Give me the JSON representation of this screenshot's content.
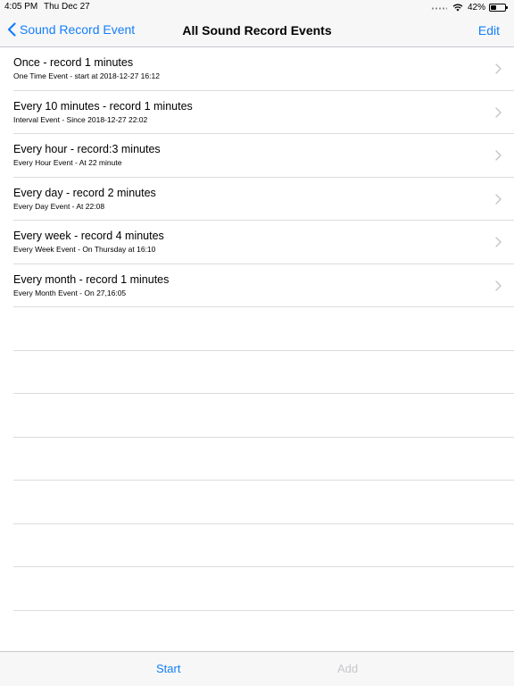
{
  "status_bar": {
    "time": "4:05 PM",
    "date": "Thu Dec 27",
    "battery_percent": "42%",
    "battery_level": 0.42
  },
  "nav": {
    "back_label": "Sound Record Event",
    "title": "All Sound Record Events",
    "edit_label": "Edit"
  },
  "events": [
    {
      "title": "Once - record 1 minutes",
      "subtitle": "One Time Event - start at 2018-12-27 16:12"
    },
    {
      "title": "Every 10 minutes - record 1 minutes",
      "subtitle": "Interval Event - Since 2018-12-27 22:02"
    },
    {
      "title": "Every hour - record:3 minutes",
      "subtitle": "Every Hour Event - At 22 minute"
    },
    {
      "title": "Every day - record 2 minutes",
      "subtitle": "Every Day Event - At 22:08"
    },
    {
      "title": "Every week - record 4 minutes",
      "subtitle": "Every Week Event - On Thursday at 16:10"
    },
    {
      "title": "Every month - record 1 minutes",
      "subtitle": "Every Month Event - On 27,16:05"
    }
  ],
  "toolbar": {
    "start_label": "Start",
    "add_label": "Add",
    "add_enabled": false
  },
  "colors": {
    "accent": "#147efb",
    "disabled": "#c7c7cc",
    "bar_background": "#f7f7f7",
    "separator": "#dcdcdf"
  }
}
